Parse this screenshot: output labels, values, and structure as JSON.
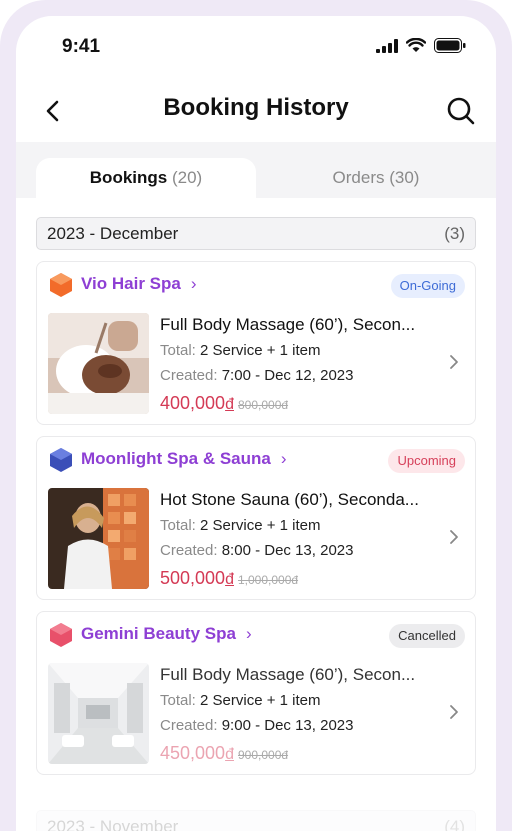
{
  "status_bar": {
    "time": "9:41"
  },
  "header": {
    "title": "Booking History"
  },
  "tabs": {
    "bookings": {
      "label": "Bookings",
      "count": "(20)"
    },
    "orders": {
      "label": "Orders",
      "count": "(30)"
    }
  },
  "months": [
    {
      "label": "2023 - December",
      "count": "(3)"
    },
    {
      "label": "2023 - November",
      "count": "(4)"
    }
  ],
  "bookings": [
    {
      "spa": "Vio Hair Spa",
      "status": "On-Going",
      "service": "Full Body Massage (60’), Secon...",
      "total_label": "Total:",
      "total_value": "2 Service + 1 item",
      "created_label": "Created:",
      "created_value": "7:00 - Dec 12, 2023",
      "price": "400,000",
      "currency": "đ",
      "old_price": "800,000đ",
      "logo_color": "#f26b2a"
    },
    {
      "spa": "Moonlight Spa & Sauna",
      "status": "Upcoming",
      "service": "Hot Stone Sauna (60’), Seconda...",
      "total_label": "Total:",
      "total_value": "2 Service + 1 item",
      "created_label": "Created:",
      "created_value": "8:00 - Dec 13, 2023",
      "price": "500,000",
      "currency": "đ",
      "old_price": "1,000,000đ",
      "logo_color": "#3b4fb8"
    },
    {
      "spa": "Gemini Beauty Spa",
      "status": "Cancelled",
      "service": "Full Body Massage (60’), Secon...",
      "total_label": "Total:",
      "total_value": "2 Service + 1 item",
      "created_label": "Created:",
      "created_value": "9:00 - Dec 13, 2023",
      "price": "450,000",
      "currency": "đ",
      "old_price": "900,000đ",
      "logo_color": "#e8506a"
    }
  ],
  "colors": {
    "accent": "#8e3fd4",
    "price": "#d43a55"
  }
}
